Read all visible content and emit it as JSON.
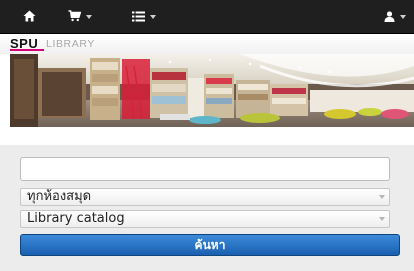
{
  "navbar": {
    "home_icon": "home-icon",
    "cart_icon": "cart-icon",
    "list_icon": "list-icon",
    "user_icon": "user-icon"
  },
  "logo": {
    "brand": "SPU",
    "library": "LIBRARY"
  },
  "search": {
    "query_value": "",
    "placeholder": "",
    "scope_selected": "ทุกห้องสมุด",
    "source_selected": "Library catalog",
    "submit_label": "ค้นหา"
  },
  "colors": {
    "navbar_bg": "#1f1f1f",
    "brand_accent": "#d6007a",
    "button_blue": "#1a5fb0"
  }
}
